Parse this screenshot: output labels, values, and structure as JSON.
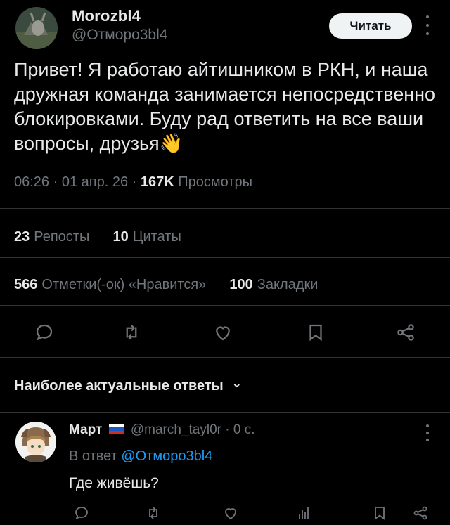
{
  "author": {
    "display_name": "Morozbl4",
    "handle": "@Отморо3bl4",
    "follow_label": "Читать"
  },
  "post": {
    "text": "Привет! Я работаю айтишником в РКН, и наша дружная команда занимается непосредственно блокировками. Буду рад ответить на все ваши вопросы, друзья",
    "emoji": "👋",
    "time": "06:26",
    "date": "01 апр. 26",
    "views_count": "167K",
    "views_label": "Просмотры",
    "separator": "·"
  },
  "stats": {
    "reposts_count": "23",
    "reposts_label": "Репосты",
    "quotes_count": "10",
    "quotes_label": "Цитаты",
    "likes_count": "566",
    "likes_label": "Отметки(-ок) «Нравится»",
    "bookmarks_count": "100",
    "bookmarks_label": "Закладки"
  },
  "actions": [
    "reply-icon",
    "repost-icon",
    "like-icon",
    "bookmark-icon",
    "share-icon"
  ],
  "replies_header": {
    "label": "Наиболее актуальные ответы",
    "chevron": "⌄"
  },
  "reply": {
    "display_name": "Март",
    "flag": "russia-flag-icon",
    "handle": "@march_tayl0r",
    "time": "0 с.",
    "reply_prefix": "В ответ",
    "reply_to": "@Отморо3bl4",
    "text": "Где живёшь?"
  },
  "colors": {
    "background": "#000000",
    "text": "#e7e9ea",
    "muted": "#71767b",
    "accent": "#1d9bf0",
    "divider": "#2f3336"
  }
}
